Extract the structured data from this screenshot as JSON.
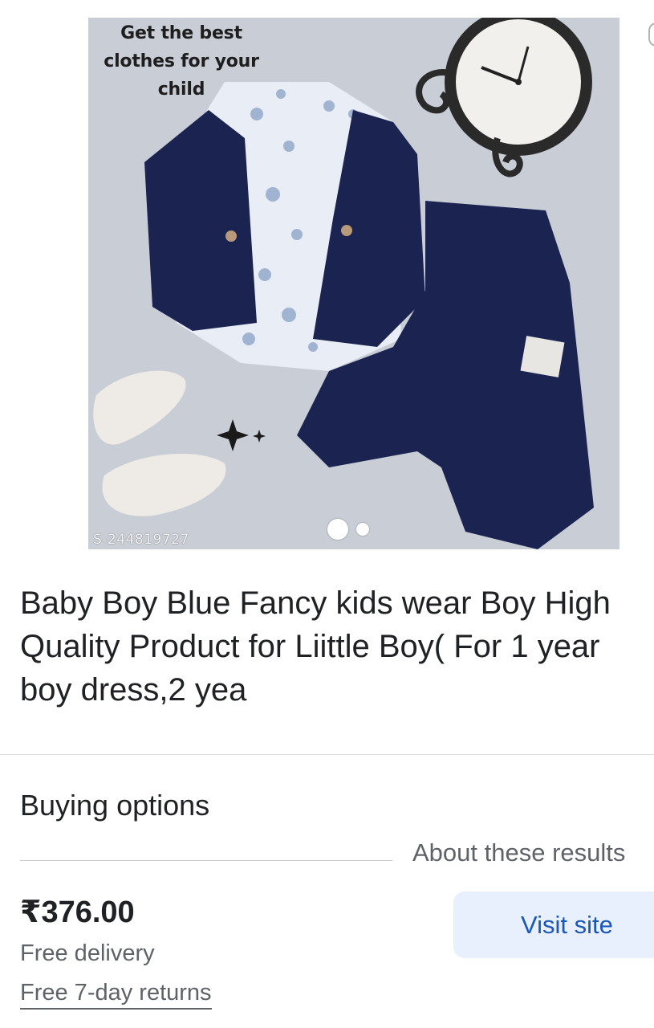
{
  "product_image": {
    "promo_lines": [
      "Get the best",
      "clothes for your",
      "child"
    ],
    "sku_watermark": "S-244819727",
    "carousel": {
      "total": 2,
      "active_index": 0
    },
    "colors": {
      "background": "#c9ced6",
      "garment_navy": "#1b2450",
      "shirt_print": "#e9eef6",
      "shoe": "#eeeae6"
    }
  },
  "title": "Baby Boy Blue Fancy kids wear Boy High Quality Product for Liittle Boy( For 1 year boy dress,2 yea",
  "buying_options": {
    "heading": "Buying options",
    "about_results": "About these results"
  },
  "offer": {
    "price": "₹376.00",
    "delivery": "Free delivery",
    "returns": "Free 7-day returns",
    "visit_label": "Visit site"
  },
  "colors": {
    "title_text": "#202124",
    "secondary_text": "#5f6368",
    "button_bg": "#e8f0fe",
    "button_text": "#1a57b8",
    "divider": "#dadce0"
  }
}
